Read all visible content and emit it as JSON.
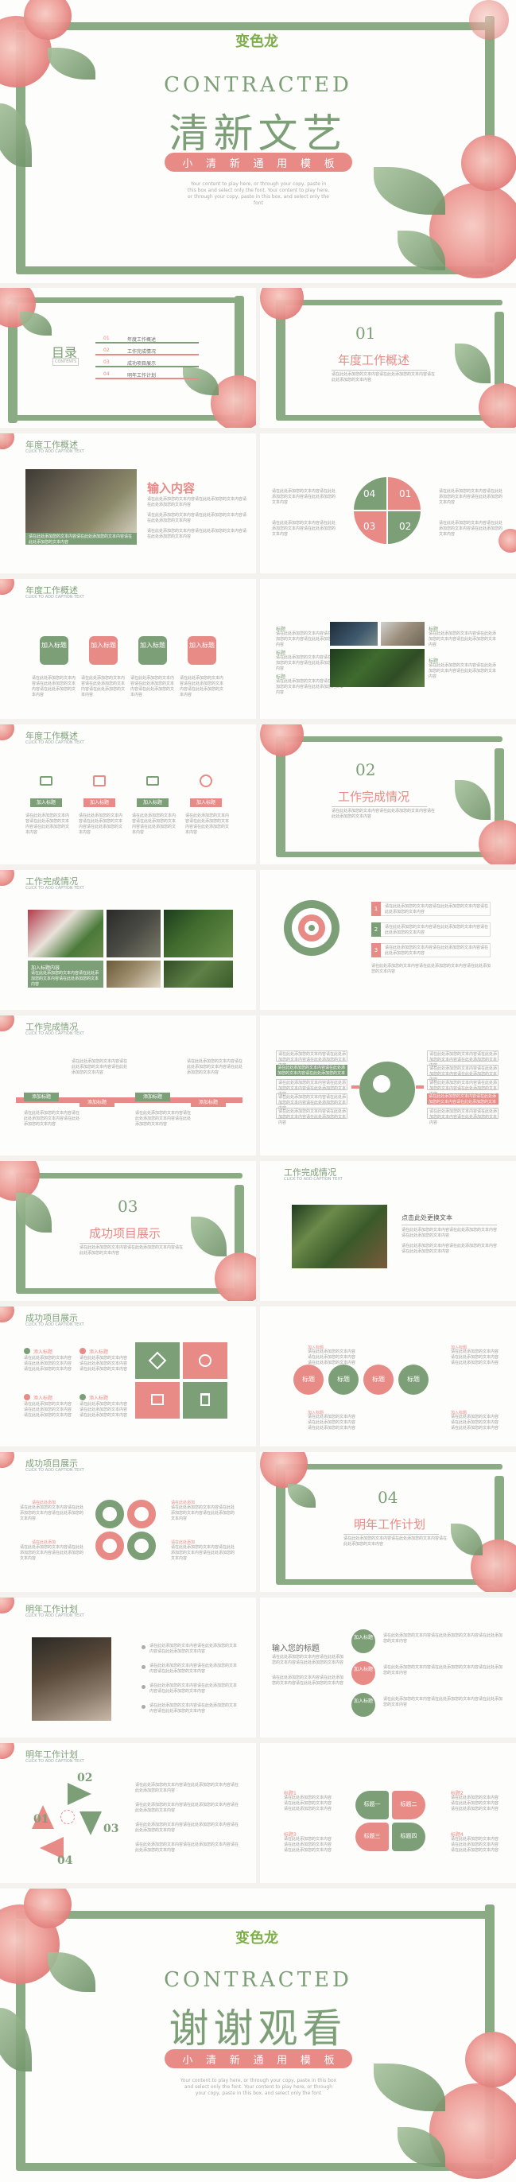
{
  "brand": {
    "name": "变色龙"
  },
  "colors": {
    "green": "#7d9f78",
    "pink": "#e88a86",
    "leaf": "#8bab85"
  },
  "cover": {
    "title_en": "CONTRACTED",
    "title_cn": "清新文艺",
    "subtitle_chars": [
      "小",
      "清",
      "新",
      "通",
      "用",
      "模",
      "板"
    ],
    "intro": "Your content to play here, or through your copy, paste in this box and select only the font. Your content to play here, or through your copy, paste in this box, and select only the font"
  },
  "toc": {
    "label": "目录",
    "label_en": "CONTENTS",
    "items": [
      {
        "num": "01",
        "text": "年度工作概述"
      },
      {
        "num": "02",
        "text": "工作完成情况"
      },
      {
        "num": "03",
        "text": "成功项目展示"
      },
      {
        "num": "04",
        "text": "明年工作计划"
      }
    ]
  },
  "sections": {
    "s1": {
      "num": "01",
      "title": "年度工作概述"
    },
    "s2": {
      "num": "02",
      "title": "工作完成情况"
    },
    "s3": {
      "num": "03",
      "title": "成功项目展示"
    },
    "s4": {
      "num": "04",
      "title": "明年工作计划"
    }
  },
  "headers": {
    "h1": "年度工作概述",
    "h2": "工作完成情况",
    "h3": "成功项目展示",
    "h4": "明年工作计划",
    "sub": "CLICK TO ADD CAPTION TEXT"
  },
  "content": {
    "input_content": "输入内容",
    "add_title": "加入标题",
    "input_title": "输入您的标题",
    "click_text": "点击此处更换文本",
    "title_word": "标题",
    "add_content_title": "加入标题内容",
    "quad_nums": [
      "04",
      "01",
      "03",
      "02"
    ],
    "arrow_nums": [
      "01",
      "02",
      "03",
      "04"
    ],
    "label_items": [
      "标题一",
      "标题二",
      "标题三",
      "标题四"
    ],
    "title_items": [
      "标题1",
      "标题2",
      "标题3",
      "标题4"
    ],
    "timeline_tags": [
      "添加标题",
      "添加标题",
      "添加标题",
      "添加标题"
    ],
    "numbered": [
      "1",
      "2",
      "3"
    ],
    "mini_items": [
      "添入标题",
      "添入标题",
      "添入标题",
      "添入标题"
    ],
    "icon_items": [
      "加入标题",
      "加入标题",
      "加入标题",
      "加入标题"
    ],
    "progress_labels": [
      "请在此处添加",
      "请在此处添加",
      "请在此处添加",
      "请在此处添加"
    ],
    "placeholder": "请在此处添加您的文本内容请在此处添加您的文本内容请在此处添加您的文本内容"
  },
  "closing": {
    "title_en": "CONTRACTED",
    "title_cn": "谢谢观看",
    "subtitle_chars": [
      "小",
      "清",
      "新",
      "通",
      "用",
      "模",
      "板"
    ],
    "intro": "Your content to play here, or through your copy, paste in this box and select only the font. Your content to play here, or through your copy, paste in this box, and select only the font"
  }
}
